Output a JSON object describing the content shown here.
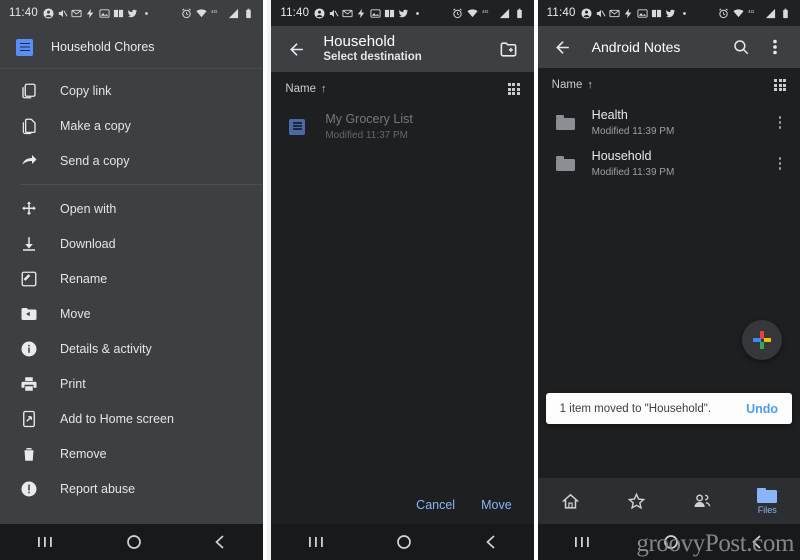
{
  "statusbar": {
    "time": "11:40",
    "left_icons": [
      "account-icon",
      "mute-icon",
      "mail-icon",
      "flash-icon",
      "photos-icon",
      "book-icon",
      "twitter-icon",
      "dot-icon"
    ],
    "right_icons": [
      "alarm-icon",
      "wifi-icon",
      "hd-icon",
      "signal-icon",
      "battery-icon"
    ]
  },
  "panel1": {
    "header": {
      "icon": "google-docs-icon",
      "title": "Household Chores"
    },
    "menu_groups": [
      {
        "items": [
          {
            "icon": "copy-link-icon",
            "label": "Copy link"
          },
          {
            "icon": "make-a-copy-icon",
            "label": "Make a copy"
          },
          {
            "icon": "send-a-copy-icon",
            "label": "Send a copy"
          }
        ]
      },
      {
        "items": [
          {
            "icon": "open-with-icon",
            "label": "Open with"
          },
          {
            "icon": "download-icon",
            "label": "Download"
          },
          {
            "icon": "rename-icon",
            "label": "Rename"
          },
          {
            "icon": "move-icon",
            "label": "Move"
          },
          {
            "icon": "details-activity-icon",
            "label": "Details & activity"
          },
          {
            "icon": "print-icon",
            "label": "Print"
          },
          {
            "icon": "add-to-home-screen-icon",
            "label": "Add to Home screen"
          },
          {
            "icon": "remove-icon",
            "label": "Remove"
          },
          {
            "icon": "report-abuse-icon",
            "label": "Report abuse"
          }
        ]
      }
    ]
  },
  "panel2": {
    "appbar": {
      "back_icon": "back-arrow-icon",
      "title": "Household",
      "subtitle": "Select destination",
      "new_folder_icon": "new-folder-icon"
    },
    "sort": {
      "label": "Name",
      "arrow": "↑",
      "view_icon": "grid-view-icon"
    },
    "files": [
      {
        "icon": "google-docs-icon",
        "title": "My Grocery List",
        "subtitle": "Modified 11:37 PM",
        "dimmed": true
      }
    ],
    "actions": {
      "cancel_label": "Cancel",
      "move_label": "Move"
    }
  },
  "panel3": {
    "appbar": {
      "back_icon": "back-arrow-icon",
      "title": "Android Notes",
      "search_icon": "search-icon",
      "overflow_icon": "more-vert-icon"
    },
    "sort": {
      "label": "Name",
      "arrow": "↑",
      "view_icon": "grid-view-icon"
    },
    "folders": [
      {
        "icon": "folder-icon",
        "title": "Health",
        "subtitle": "Modified 11:39 PM",
        "menu_icon": "more-vert-icon"
      },
      {
        "icon": "folder-icon",
        "title": "Household",
        "subtitle": "Modified 11:39 PM",
        "menu_icon": "more-vert-icon"
      }
    ],
    "fab": {
      "icon": "google-plus-icon"
    },
    "snackbar": {
      "message": "1 item moved to \"Household\".",
      "action_label": "Undo"
    },
    "tabs": [
      {
        "icon": "home-icon",
        "label": "",
        "active": false
      },
      {
        "icon": "starred-icon",
        "label": "",
        "active": false
      },
      {
        "icon": "shared-icon",
        "label": "",
        "active": false
      },
      {
        "icon": "files-folder-icon",
        "label": "Files",
        "active": true
      }
    ]
  },
  "sysnav": {
    "recents_icon": "recents-icon",
    "home_icon": "home-circle-icon",
    "back_icon": "back-chevron-icon"
  },
  "watermark": "groovyPost.com",
  "colors": {
    "accent_blue": "#8ab4f8",
    "snackbar_action": "#4a9df0",
    "panel_bg": "#1d1f21",
    "menu_bg": "#3c4043",
    "docs_blue": "#5c8df6"
  }
}
